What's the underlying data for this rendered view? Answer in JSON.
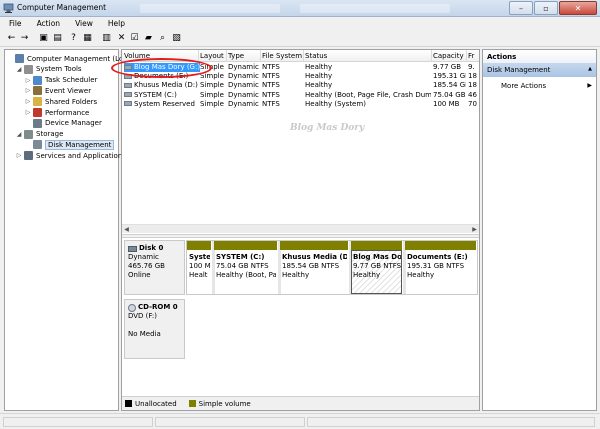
{
  "window": {
    "title": "Computer Management",
    "ghost_tabs": 2
  },
  "menu": [
    {
      "label": "File"
    },
    {
      "label": "Action"
    },
    {
      "label": "View"
    },
    {
      "label": "Help"
    }
  ],
  "toolbar": [
    {
      "icon": "back-arrow-icon",
      "glyph": "←"
    },
    {
      "icon": "forward-arrow-icon",
      "glyph": "→"
    },
    {
      "icon": "up-folder-icon",
      "glyph": "▣"
    },
    {
      "icon": "console-tree-icon",
      "glyph": "▤"
    },
    {
      "icon": "help-icon",
      "glyph": "?"
    },
    {
      "icon": "properties-icon",
      "glyph": "▦"
    },
    {
      "icon": "disk-list-icon",
      "glyph": "▥"
    },
    {
      "icon": "delete-icon",
      "glyph": "✕"
    },
    {
      "icon": "checklist-icon",
      "glyph": "☑"
    },
    {
      "icon": "open-folder-icon",
      "glyph": "▰"
    },
    {
      "icon": "search-icon",
      "glyph": "⌕"
    },
    {
      "icon": "view-icon",
      "glyph": "▧"
    }
  ],
  "tree": [
    {
      "label": "Computer Management (Local",
      "level": 0,
      "expander": "",
      "icon_color": "#5b7fa8"
    },
    {
      "label": "System Tools",
      "level": 1,
      "expander": "◢",
      "icon_color": "#8f8f8f"
    },
    {
      "label": "Task Scheduler",
      "level": 2,
      "expander": "▷",
      "icon_color": "#4e8ac9"
    },
    {
      "label": "Event Viewer",
      "level": 2,
      "expander": "▷",
      "icon_color": "#8a6f3a"
    },
    {
      "label": "Shared Folders",
      "level": 2,
      "expander": "▷",
      "icon_color": "#d9b343"
    },
    {
      "label": "Performance",
      "level": 2,
      "expander": "▷",
      "icon_color": "#c0392b"
    },
    {
      "label": "Device Manager",
      "level": 2,
      "expander": "",
      "icon_color": "#6c7a89"
    },
    {
      "label": "Storage",
      "level": 1,
      "expander": "◢",
      "icon_color": "#7f8c8d"
    },
    {
      "label": "Disk Management",
      "level": 2,
      "expander": "",
      "icon_color": "#7b8a99",
      "selected": true
    },
    {
      "label": "Services and Applications",
      "level": 1,
      "expander": "▷",
      "icon_color": "#5d6d7e"
    }
  ],
  "volume_table": {
    "columns": [
      "Volume",
      "Layout",
      "Type",
      "File System",
      "Status",
      "Capacity",
      "Fr"
    ],
    "rows": [
      [
        "Blog Mas Dory (G:)",
        "Simple",
        "Dynamic",
        "NTFS",
        "Healthy",
        "9.77 GB",
        "9."
      ],
      [
        "Documents (E:)",
        "Simple",
        "Dynamic",
        "NTFS",
        "Healthy",
        "195.31 GB",
        "18"
      ],
      [
        "Khusus Media (D:)",
        "Simple",
        "Dynamic",
        "NTFS",
        "Healthy",
        "185.54 GB",
        "18"
      ],
      [
        "SYSTEM (C:)",
        "Simple",
        "Dynamic",
        "NTFS",
        "Healthy (Boot, Page File, Crash Dump)",
        "75.04 GB",
        "46"
      ],
      [
        "System Reserved",
        "Simple",
        "Dynamic",
        "NTFS",
        "Healthy (System)",
        "100 MB",
        "70"
      ]
    ],
    "selected_row": 0
  },
  "watermark": "Blog Mas Dory",
  "disks": [
    {
      "name": "Disk 0",
      "lines": [
        "Dynamic",
        "465.76 GB",
        "Online"
      ],
      "partitions": [
        {
          "name": "Syste",
          "size": "100 M",
          "status": "Healt"
        },
        {
          "name": "SYSTEM  (C:)",
          "size": "75.04 GB NTFS",
          "status": "Healthy (Boot, Pag"
        },
        {
          "name": "Khusus Media  (D:)",
          "size": "185.54 GB NTFS",
          "status": "Healthy"
        },
        {
          "name": "Blog Mas Dor",
          "size": "9.77 GB NTFS",
          "status": "Healthy"
        },
        {
          "name": "Documents  (E:)",
          "size": "195.31 GB NTFS",
          "status": "Healthy"
        }
      ]
    },
    {
      "name": "CD-ROM 0",
      "lines": [
        "DVD (F:)",
        "",
        "No Media"
      ],
      "partitions": []
    }
  ],
  "legend": [
    {
      "label": "Unallocated",
      "color": "#000000"
    },
    {
      "label": "Simple volume",
      "color": "#808000"
    }
  ],
  "actions": {
    "title": "Actions",
    "section": "Disk Management",
    "section_arrow": "▲",
    "item": "More Actions",
    "item_arrow": "▶"
  },
  "colors": {
    "accent": "#3399ff",
    "simple_volume": "#808000",
    "highlight": "#e31b1b"
  }
}
